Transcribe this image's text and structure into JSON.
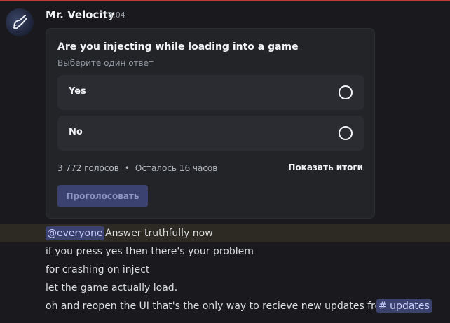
{
  "message": {
    "author": "Mr. Velocity",
    "timestamp": "8:04",
    "avatar_icon": "comet-logo-icon"
  },
  "poll": {
    "question": "Are you injecting while loading into a game",
    "hint": "Выберите один ответ",
    "options": [
      {
        "label": "Yes"
      },
      {
        "label": "No"
      }
    ],
    "votes": "3 772 голосов",
    "separator": "•",
    "time_left": "Осталось 16 часов",
    "show_results": "Показать итоги",
    "vote_button": "Проголосовать"
  },
  "body": {
    "mention": "@everyone",
    "line1": "Answer truthfully now",
    "line2": "if you press yes then there's your problem",
    "line3": "for crashing on inject",
    "line4": "let the game actually load.",
    "line5": "oh and reopen the UI that's the only way to recieve new updates from",
    "channel": "# updates"
  },
  "colors": {
    "background": "#1a1a1e",
    "poll_background": "#232428",
    "option_background": "#2b2c31",
    "mention_background": "#3c4270",
    "mention_highlight_row": "#2c2a22"
  }
}
